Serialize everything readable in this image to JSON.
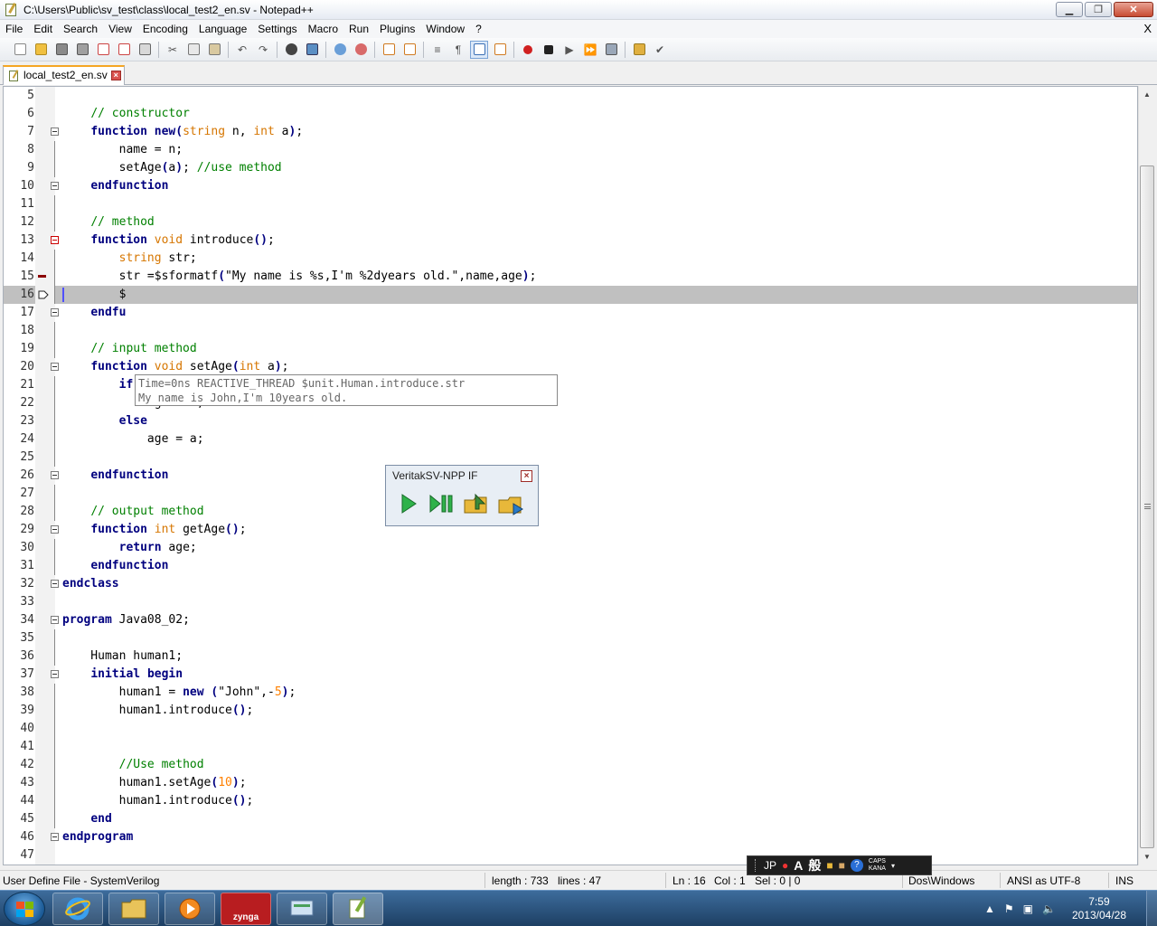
{
  "window": {
    "title": "C:\\Users\\Public\\sv_test\\class\\local_test2_en.sv - Notepad++",
    "minimize_glyph": "▁",
    "maximize_glyph": "❐",
    "close_glyph": "✕"
  },
  "menu": {
    "items": [
      "File",
      "Edit",
      "Search",
      "View",
      "Encoding",
      "Language",
      "Settings",
      "Macro",
      "Run",
      "Plugins",
      "Window",
      "?"
    ],
    "close_glyph": "X"
  },
  "tab": {
    "label": "local_test2_en.sv",
    "close_glyph": "×"
  },
  "editor": {
    "lines": [
      {
        "n": "5",
        "fold": "none",
        "marker": "",
        "tokens": []
      },
      {
        "n": "6",
        "fold": "none",
        "marker": "",
        "tokens": [
          {
            "t": "    "
          },
          {
            "t": "// constructor",
            "c": "cm"
          }
        ]
      },
      {
        "n": "7",
        "fold": "box",
        "marker": "",
        "tokens": [
          {
            "t": "    "
          },
          {
            "t": "function",
            "c": "kw"
          },
          {
            "t": " "
          },
          {
            "t": "new",
            "c": "kw"
          },
          {
            "t": "(",
            "c": "pn"
          },
          {
            "t": "string",
            "c": "ty"
          },
          {
            "t": " n, "
          },
          {
            "t": "int",
            "c": "ty"
          },
          {
            "t": " a"
          },
          {
            "t": ")",
            "c": "pn"
          },
          {
            "t": ";"
          }
        ]
      },
      {
        "n": "8",
        "fold": "line",
        "marker": "",
        "tokens": [
          {
            "t": "        name = n;"
          }
        ]
      },
      {
        "n": "9",
        "fold": "line",
        "marker": "",
        "tokens": [
          {
            "t": "        setAge"
          },
          {
            "t": "(",
            "c": "pn"
          },
          {
            "t": "a"
          },
          {
            "t": ")",
            "c": "pn"
          },
          {
            "t": "; "
          },
          {
            "t": "//use method",
            "c": "cm"
          }
        ]
      },
      {
        "n": "10",
        "fold": "box",
        "marker": "",
        "tokens": [
          {
            "t": "    "
          },
          {
            "t": "endfunction",
            "c": "kw"
          }
        ]
      },
      {
        "n": "11",
        "fold": "line",
        "marker": "",
        "tokens": []
      },
      {
        "n": "12",
        "fold": "line",
        "marker": "",
        "tokens": [
          {
            "t": "    "
          },
          {
            "t": "// method",
            "c": "cm"
          }
        ]
      },
      {
        "n": "13",
        "fold": "red",
        "marker": "",
        "tokens": [
          {
            "t": "    "
          },
          {
            "t": "function",
            "c": "kw"
          },
          {
            "t": " "
          },
          {
            "t": "void",
            "c": "ty"
          },
          {
            "t": " introduce"
          },
          {
            "t": "()",
            "c": "pn"
          },
          {
            "t": ";"
          }
        ]
      },
      {
        "n": "14",
        "fold": "line",
        "marker": "",
        "tokens": [
          {
            "t": "        "
          },
          {
            "t": "string",
            "c": "ty"
          },
          {
            "t": " str;"
          }
        ]
      },
      {
        "n": "15",
        "fold": "line",
        "marker": "breakpoint",
        "tokens": [
          {
            "t": "        str =$sformatf"
          },
          {
            "t": "(",
            "c": "pn"
          },
          {
            "t": "\"My name is %s,I'm %2dyears old.\",name,age"
          },
          {
            "t": ")",
            "c": "pn"
          },
          {
            "t": ";"
          }
        ]
      },
      {
        "n": "16",
        "fold": "line",
        "marker": "arrow",
        "current": true,
        "tokens": [
          {
            "t": "        $"
          }
        ]
      },
      {
        "n": "17",
        "fold": "box",
        "marker": "",
        "tokens": [
          {
            "t": "    "
          },
          {
            "t": "endfu",
            "c": "kw"
          }
        ]
      },
      {
        "n": "18",
        "fold": "line",
        "marker": "",
        "tokens": []
      },
      {
        "n": "19",
        "fold": "line",
        "marker": "",
        "tokens": [
          {
            "t": "    "
          },
          {
            "t": "// input method",
            "c": "cm"
          }
        ]
      },
      {
        "n": "20",
        "fold": "box",
        "marker": "",
        "tokens": [
          {
            "t": "    "
          },
          {
            "t": "function",
            "c": "kw"
          },
          {
            "t": " "
          },
          {
            "t": "void",
            "c": "ty"
          },
          {
            "t": " setAge"
          },
          {
            "t": "(",
            "c": "pn"
          },
          {
            "t": "int",
            "c": "ty"
          },
          {
            "t": " a"
          },
          {
            "t": ")",
            "c": "pn"
          },
          {
            "t": ";"
          }
        ]
      },
      {
        "n": "21",
        "fold": "line",
        "marker": "",
        "tokens": [
          {
            "t": "        "
          },
          {
            "t": "if",
            "c": "kw"
          },
          {
            "t": " "
          },
          {
            "t": "(",
            "c": "pn"
          },
          {
            "t": "a < "
          },
          {
            "t": "0",
            "c": "num"
          },
          {
            "t": ")",
            "c": "pn"
          }
        ]
      },
      {
        "n": "22",
        "fold": "line",
        "marker": "",
        "tokens": [
          {
            "t": "            age = "
          },
          {
            "t": "0",
            "c": "num"
          },
          {
            "t": ";"
          }
        ]
      },
      {
        "n": "23",
        "fold": "line",
        "marker": "",
        "tokens": [
          {
            "t": "        "
          },
          {
            "t": "else",
            "c": "kw"
          }
        ]
      },
      {
        "n": "24",
        "fold": "line",
        "marker": "",
        "tokens": [
          {
            "t": "            age = a;"
          }
        ]
      },
      {
        "n": "25",
        "fold": "line",
        "marker": "",
        "tokens": []
      },
      {
        "n": "26",
        "fold": "box",
        "marker": "",
        "tokens": [
          {
            "t": "    "
          },
          {
            "t": "endfunction",
            "c": "kw"
          }
        ]
      },
      {
        "n": "27",
        "fold": "line",
        "marker": "",
        "tokens": []
      },
      {
        "n": "28",
        "fold": "line",
        "marker": "",
        "tokens": [
          {
            "t": "    "
          },
          {
            "t": "// output method",
            "c": "cm"
          }
        ]
      },
      {
        "n": "29",
        "fold": "box",
        "marker": "",
        "tokens": [
          {
            "t": "    "
          },
          {
            "t": "function",
            "c": "kw"
          },
          {
            "t": " "
          },
          {
            "t": "int",
            "c": "ty"
          },
          {
            "t": " getAge"
          },
          {
            "t": "()",
            "c": "pn"
          },
          {
            "t": ";"
          }
        ]
      },
      {
        "n": "30",
        "fold": "line",
        "marker": "",
        "tokens": [
          {
            "t": "        "
          },
          {
            "t": "return",
            "c": "kw"
          },
          {
            "t": " age;"
          }
        ]
      },
      {
        "n": "31",
        "fold": "line",
        "marker": "",
        "tokens": [
          {
            "t": "    "
          },
          {
            "t": "endfunction",
            "c": "kw"
          }
        ]
      },
      {
        "n": "32",
        "fold": "box",
        "marker": "",
        "tokens": [
          {
            "t": "endclass",
            "c": "kw"
          }
        ]
      },
      {
        "n": "33",
        "fold": "none",
        "marker": "",
        "tokens": []
      },
      {
        "n": "34",
        "fold": "box",
        "marker": "",
        "tokens": [
          {
            "t": "program",
            "c": "kw"
          },
          {
            "t": " Java08_02;"
          }
        ]
      },
      {
        "n": "35",
        "fold": "line",
        "marker": "",
        "tokens": []
      },
      {
        "n": "36",
        "fold": "line",
        "marker": "",
        "tokens": [
          {
            "t": "    Human human1;"
          }
        ]
      },
      {
        "n": "37",
        "fold": "box",
        "marker": "",
        "tokens": [
          {
            "t": "    "
          },
          {
            "t": "initial",
            "c": "kw"
          },
          {
            "t": " "
          },
          {
            "t": "begin",
            "c": "kw"
          }
        ]
      },
      {
        "n": "38",
        "fold": "line",
        "marker": "",
        "tokens": [
          {
            "t": "        human1 = "
          },
          {
            "t": "new",
            "c": "kw"
          },
          {
            "t": " "
          },
          {
            "t": "(",
            "c": "pn"
          },
          {
            "t": "\"John\",-"
          },
          {
            "t": "5",
            "c": "num"
          },
          {
            "t": ")",
            "c": "pn"
          },
          {
            "t": ";"
          }
        ]
      },
      {
        "n": "39",
        "fold": "line",
        "marker": "",
        "tokens": [
          {
            "t": "        human1.introduce"
          },
          {
            "t": "()",
            "c": "pn"
          },
          {
            "t": ";"
          }
        ]
      },
      {
        "n": "40",
        "fold": "line",
        "marker": "",
        "tokens": []
      },
      {
        "n": "41",
        "fold": "line",
        "marker": "",
        "tokens": []
      },
      {
        "n": "42",
        "fold": "line",
        "marker": "",
        "tokens": [
          {
            "t": "        "
          },
          {
            "t": "//Use method",
            "c": "cm"
          }
        ]
      },
      {
        "n": "43",
        "fold": "line",
        "marker": "",
        "tokens": [
          {
            "t": "        human1.setAge"
          },
          {
            "t": "(",
            "c": "pn"
          },
          {
            "t": "10",
            "c": "num"
          },
          {
            "t": ")",
            "c": "pn"
          },
          {
            "t": ";"
          }
        ]
      },
      {
        "n": "44",
        "fold": "line",
        "marker": "",
        "tokens": [
          {
            "t": "        human1.introduce"
          },
          {
            "t": "()",
            "c": "pn"
          },
          {
            "t": ";"
          }
        ]
      },
      {
        "n": "45",
        "fold": "line",
        "marker": "",
        "tokens": [
          {
            "t": "    "
          },
          {
            "t": "end",
            "c": "kw"
          }
        ]
      },
      {
        "n": "46",
        "fold": "box",
        "marker": "",
        "tokens": [
          {
            "t": "endprogram",
            "c": "kw"
          }
        ]
      },
      {
        "n": "47",
        "fold": "none",
        "marker": "",
        "tokens": []
      }
    ]
  },
  "tooltip": {
    "line1": "Time=0ns REACTIVE_THREAD $unit.Human.introduce.str",
    "line2": "My name is John,I'm 10years old."
  },
  "veritak_panel": {
    "title": "VeritakSV-NPP IF",
    "close_glyph": "×"
  },
  "langbar": {
    "lang": "JP",
    "ime_a": "A",
    "ime_mode": "般",
    "caps": "CAPS",
    "kana": "KANA"
  },
  "status": {
    "file_type": "User Define File - SystemVerilog",
    "length": "length : 733",
    "lines": "lines : 47",
    "ln": "Ln : 16",
    "col": "Col : 1",
    "sel": "Sel : 0 | 0",
    "eol": "Dos\\Windows",
    "encoding": "ANSI as UTF-8",
    "mode": "INS"
  },
  "taskbar": {
    "zynga_label": "zynga",
    "clock_time": "7:59",
    "clock_date": "2013/04/28"
  },
  "colors": {
    "keyword": "#00007f",
    "type": "#d67600",
    "comment": "#008000",
    "number": "#ff8000",
    "current_line": "#c0c0c0",
    "tab_accent": "#f5a623"
  }
}
